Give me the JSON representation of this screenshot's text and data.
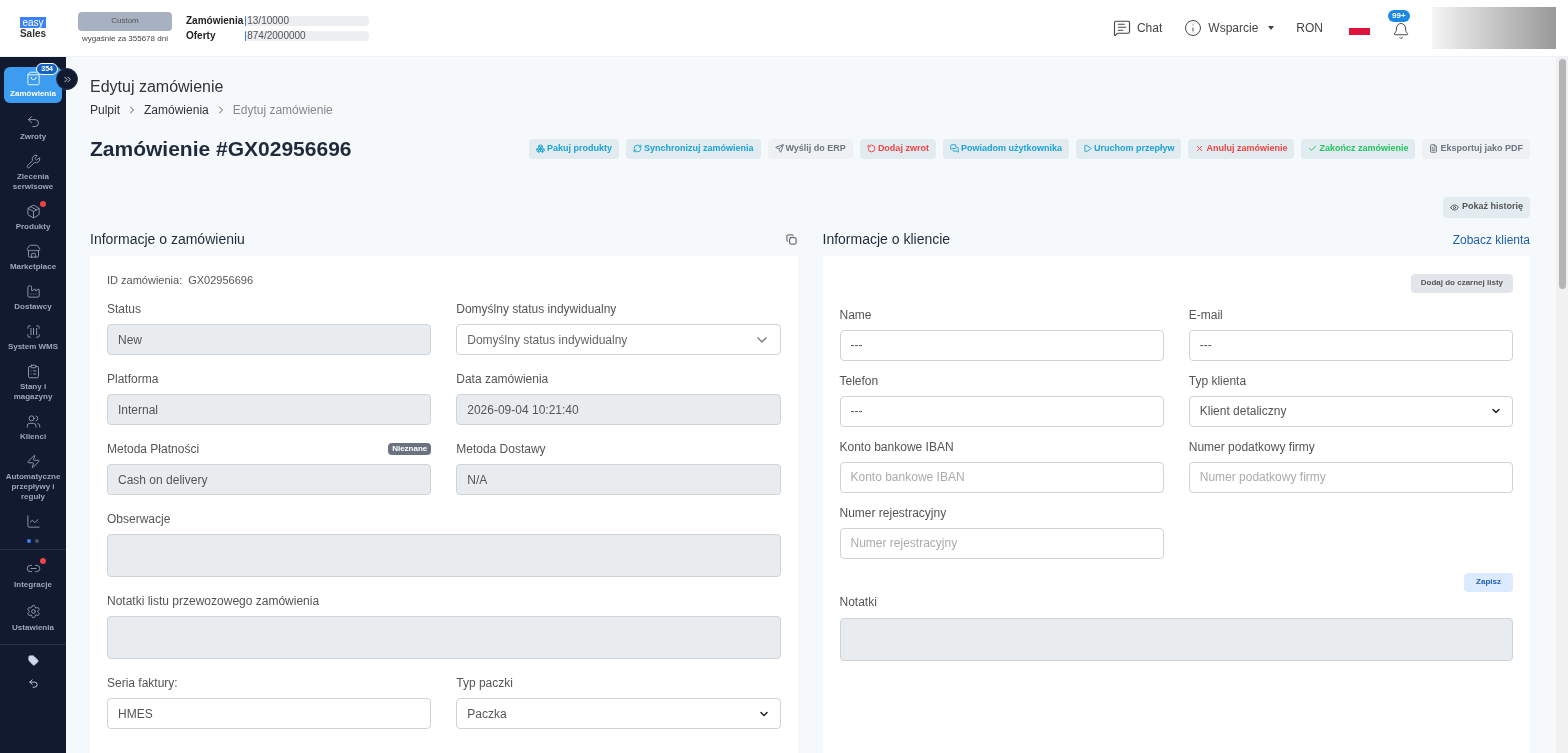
{
  "header": {
    "logo": {
      "top": "easy",
      "bottom": "Sales"
    },
    "plan": {
      "name": "Custom",
      "expiry": "wygaśnie za 355678 dni"
    },
    "usage": [
      {
        "label": "Zamówienia",
        "value": "13/10000",
        "level": 0.01
      },
      {
        "label": "Oferty",
        "value": "874/2000000",
        "level": 0.01
      }
    ],
    "chat": "Chat",
    "support": "Wsparcie",
    "currency": "RON",
    "notifications": "99+"
  },
  "sidebar": {
    "items": [
      {
        "label": "Zamówienia",
        "selected": true,
        "badge": "354",
        "dot": false
      },
      {
        "label": "Zwroty",
        "selected": false,
        "dot": false
      },
      {
        "label": "Zlecenia serwisowe",
        "selected": false,
        "dot": false
      },
      {
        "label": "Produkty",
        "selected": false,
        "dot": true
      },
      {
        "label": "Marketplace",
        "selected": false,
        "dot": false
      },
      {
        "label": "Dostawcy",
        "selected": false,
        "dot": false
      },
      {
        "label": "System WMS",
        "selected": false,
        "dot": false
      },
      {
        "label": "Stany i magazyny",
        "selected": false,
        "dot": false
      },
      {
        "label": "Klienci",
        "selected": false,
        "dot": false
      },
      {
        "label": "Automatyczne przepływy i reguły",
        "selected": false,
        "dot": false
      },
      {
        "selected": false,
        "dot": false
      }
    ],
    "pages": [
      {
        "selected": true
      },
      {
        "selected": false
      }
    ],
    "bottom_items": [
      {
        "label": "Integracje",
        "dot": true
      },
      {
        "label": "Ustawienia",
        "dot": false
      }
    ]
  },
  "page": {
    "title": "Edytuj zamówienie",
    "breadcrumbs": [
      "Pulpit",
      "Zamówienia",
      "Edytuj zamówienie"
    ],
    "order_title": "Zamówienie #GX02956696",
    "actions": [
      {
        "label": "Pakuj produkty",
        "color": "#1aa3d6",
        "disabled": false
      },
      {
        "label": "Synchronizuj zamówienia",
        "color": "#1aa3d6",
        "disabled": false
      },
      {
        "label": "Wyślij do ERP",
        "color": "#6b7580",
        "disabled": true
      },
      {
        "label": "Dodaj zwrot",
        "color": "#ef4444",
        "disabled": false
      },
      {
        "label": "Powiadom użytkownika",
        "color": "#1aa3d6",
        "disabled": false
      },
      {
        "label": "Uruchom przepływ",
        "color": "#1aa3d6",
        "disabled": false
      },
      {
        "label": "Anuluj zamówienie",
        "color": "#ef4444",
        "disabled": false
      },
      {
        "label": "Zakończ zamówienie",
        "color": "#22c55e",
        "disabled": false
      },
      {
        "label": "Eksportuj jako PDF",
        "color": "#6b7580",
        "disabled": true
      }
    ],
    "history_button": "Pokaż historię"
  },
  "order_info": {
    "title": "Informacje o zamówieniu",
    "id_label": "ID zamówienia:",
    "id_value": "GX02956696",
    "fields": [
      {
        "kind": "text",
        "label": "Status",
        "value": "New",
        "disabled": true
      },
      {
        "kind": "select",
        "label": "Domyślny status indywidualny",
        "value": "Domyślny status indywidualny",
        "disabled": false
      },
      {
        "kind": "text",
        "label": "Platforma",
        "value": "Internal",
        "disabled": true
      },
      {
        "kind": "text",
        "label": "Data zamówienia",
        "value": "2026-09-04 10:21:40",
        "disabled": true
      },
      {
        "kind": "text",
        "label": "Metoda Płatności",
        "badge": "Nieznane",
        "value": "Cash on delivery",
        "disabled": true
      },
      {
        "kind": "text",
        "label": "Metoda Dostawy",
        "value": "N/A",
        "disabled": true
      },
      {
        "kind": "textarea",
        "label": "Obserwacje",
        "disabled": true
      },
      {
        "kind": "textarea",
        "label": "Notatki listu przewozowego zamówienia",
        "disabled": true
      },
      {
        "kind": "text",
        "label": "Seria faktury:",
        "value": "HMES",
        "disabled": false
      },
      {
        "kind": "native-select",
        "label": "Typ paczki",
        "value": "Paczka",
        "disabled": false
      }
    ]
  },
  "client_info": {
    "title": "Informacje o kliencie",
    "link": "Zobacz klienta",
    "blacklist_button": "Dodaj do czarnej listy",
    "fields": [
      {
        "kind": "text",
        "label": "Name",
        "value": "---",
        "disabled": false
      },
      {
        "kind": "text",
        "label": "E-mail",
        "value": "---",
        "disabled": false
      },
      {
        "kind": "text",
        "label": "Telefon",
        "value": "---",
        "disabled": false
      },
      {
        "kind": "native-select",
        "label": "Typ klienta",
        "value": "Klient detaliczny",
        "disabled": false
      },
      {
        "kind": "text",
        "label": "Konto bankowe IBAN",
        "placeholder": "Konto bankowe IBAN",
        "disabled": false
      },
      {
        "kind": "text",
        "label": "Numer podatkowy firmy",
        "placeholder": "Numer podatkowy firmy",
        "disabled": false
      },
      {
        "kind": "text",
        "label": "Numer rejestracyjny",
        "placeholder": "Numer rejestracyjny",
        "disabled": false
      }
    ],
    "save_button": "Zapisz",
    "notes_label": "Notatki"
  }
}
